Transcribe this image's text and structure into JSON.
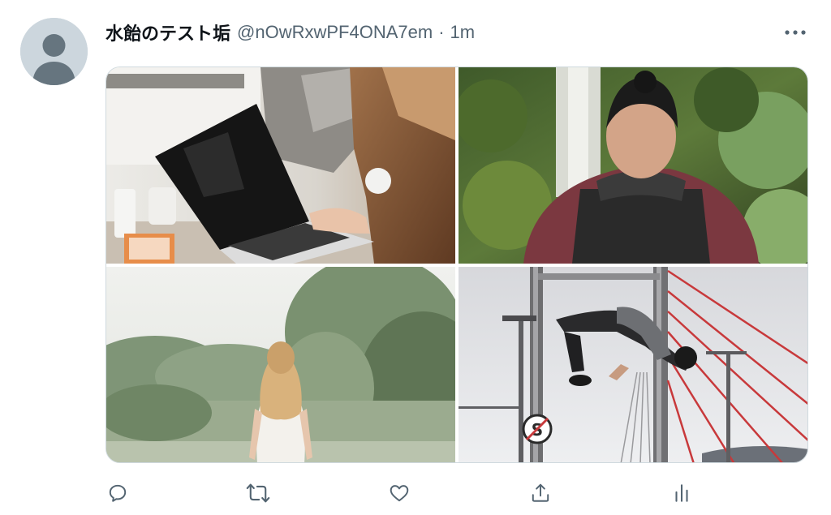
{
  "tweet": {
    "display_name": "水飴のテスト垢",
    "handle": "@nOwRxwPF4ONA7em",
    "separator": "·",
    "time": "1m"
  },
  "icons": {
    "avatar": "default-avatar-icon",
    "more": "more-horizontal-icon",
    "reply": "reply-icon",
    "retweet": "retweet-icon",
    "like": "heart-icon",
    "share": "share-icon",
    "analytics": "analytics-icon"
  },
  "media": {
    "images": [
      {
        "alt": "photo-laptop"
      },
      {
        "alt": "photo-man-backpack"
      },
      {
        "alt": "photo-woman-forest"
      },
      {
        "alt": "photo-bridge-jump"
      }
    ]
  },
  "colors": {
    "secondary_text": "#536471",
    "border": "#cfd9de",
    "avatar_bg": "#ccd6dd"
  }
}
